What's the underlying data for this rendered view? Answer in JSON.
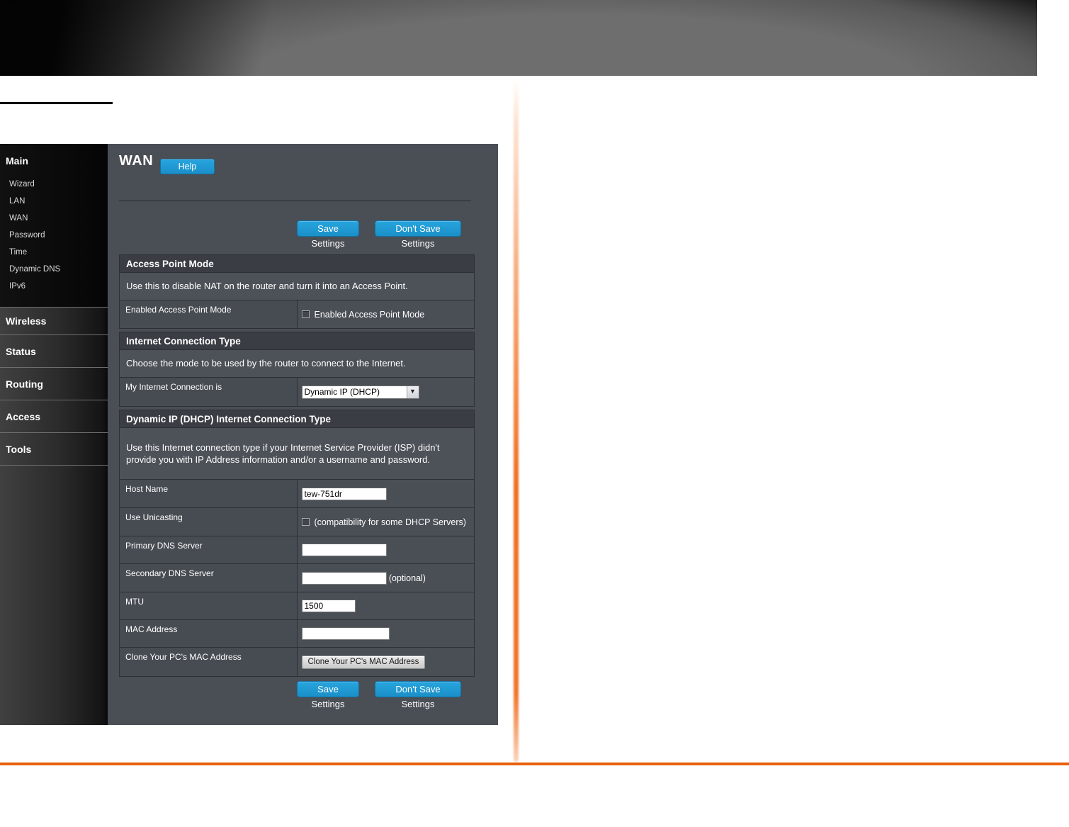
{
  "sidebar": {
    "main": {
      "label": "Main",
      "sub_items": [
        "Wizard",
        "LAN",
        "WAN",
        "Password",
        "Time",
        "Dynamic DNS",
        "IPv6"
      ]
    },
    "sections": [
      "Wireless",
      "Status",
      "Routing",
      "Access",
      "Tools"
    ]
  },
  "content": {
    "title": "WAN",
    "help_button": "Help",
    "save_button": "Save Settings",
    "dont_save_button": "Don't Save Settings",
    "access_point_mode": {
      "header": "Access Point Mode",
      "description": "Use this to disable NAT on the router and turn it into an Access Point.",
      "row_label": "Enabled Access Point Mode",
      "checkbox_label": "Enabled Access Point Mode",
      "checkbox_checked": false
    },
    "internet_connection_type": {
      "header": "Internet Connection Type",
      "description": "Choose the mode to be used by the router to connect to the Internet.",
      "row_label": "My Internet Connection is",
      "select_value": "Dynamic IP (DHCP)"
    },
    "dynamic_ip": {
      "header": "Dynamic IP (DHCP) Internet Connection Type",
      "description": "Use this Internet connection type if your Internet Service Provider (ISP) didn't provide you with IP Address information and/or a username and password.",
      "host_name": {
        "label": "Host Name",
        "value": "tew-751dr"
      },
      "use_unicasting": {
        "label": "Use Unicasting",
        "note": "(compatibility for some DHCP Servers)",
        "checked": false
      },
      "primary_dns": {
        "label": "Primary DNS Server",
        "value": ""
      },
      "secondary_dns": {
        "label": "Secondary DNS Server",
        "value": "",
        "note": "(optional)"
      },
      "mtu": {
        "label": "MTU",
        "value": "1500"
      },
      "mac_address": {
        "label": "MAC Address",
        "value": ""
      },
      "clone_mac": {
        "label": "Clone Your PC's MAC Address",
        "button": "Clone Your PC's MAC Address"
      }
    }
  },
  "icons": {
    "select_arrow": "▼"
  },
  "colors": {
    "accent_blue": "#1e9cd8",
    "accent_orange": "#e8600c",
    "panel_bg": "#4a4e55"
  }
}
